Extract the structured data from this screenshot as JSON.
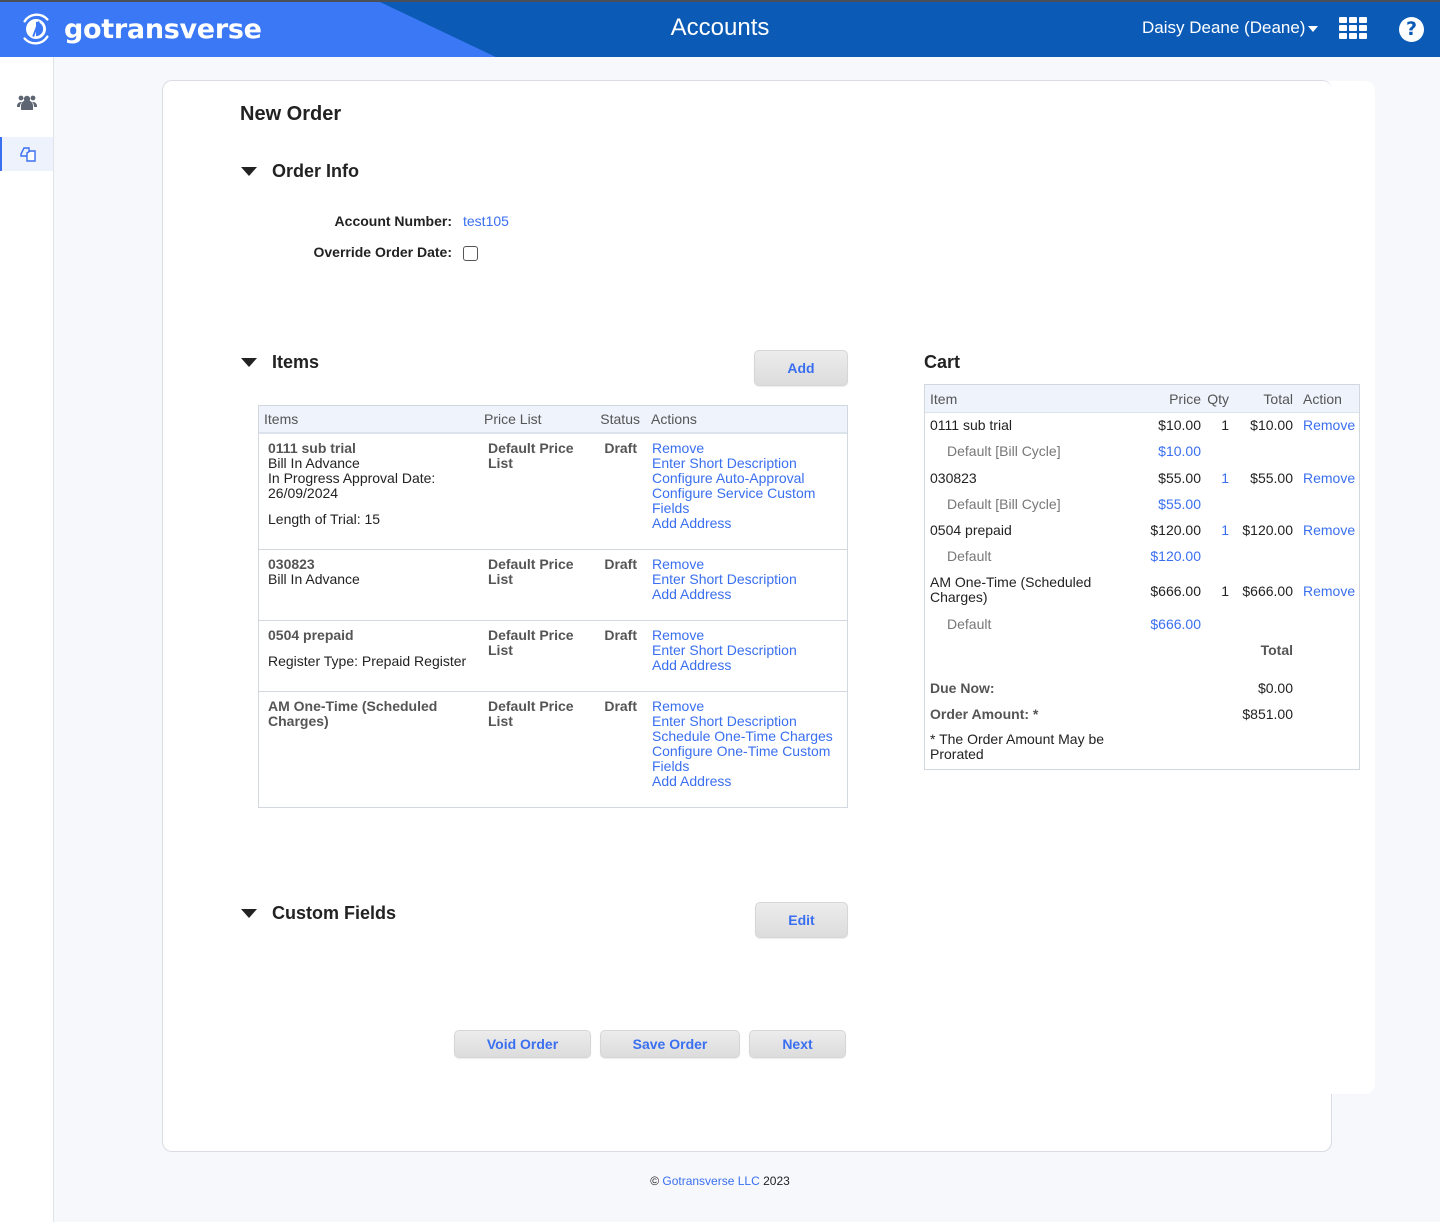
{
  "header": {
    "brand": "gotransverse",
    "title": "Accounts",
    "user": "Daisy Deane (Deane)",
    "help_glyph": "?",
    "icons": [
      "logo-icon",
      "apps-grid-icon",
      "help-icon"
    ],
    "colors": {
      "bar": "#0b5bb6",
      "brand_panel": "#3b78f5",
      "link": "#3a6ff0"
    }
  },
  "sidebar": {
    "items": [
      {
        "name": "accounts",
        "icon": "users-icon",
        "active": false
      },
      {
        "name": "orders",
        "icon": "orders-icon",
        "active": true
      }
    ]
  },
  "page": {
    "title": "New Order",
    "order_info": {
      "heading": "Order Info",
      "account_number_label": "Account Number:",
      "account_number": "test105",
      "override_date_label": "Override Order Date:",
      "override_date_checked": false
    },
    "items": {
      "heading": "Items",
      "add_label": "Add",
      "columns": [
        "Items",
        "Price List",
        "Status",
        "Actions"
      ],
      "rows": [
        {
          "name": "0111 sub trial",
          "details": [
            "Bill In Advance",
            "In Progress Approval Date:",
            "26/09/2024"
          ],
          "extra": "Length of Trial: 15",
          "price_list": "Default Price List",
          "status": "Draft",
          "actions": [
            "Remove",
            "Enter Short Description",
            "Configure Auto-Approval",
            "Configure Service Custom Fields",
            "Add Address"
          ]
        },
        {
          "name": "030823",
          "details": [
            "Bill In Advance"
          ],
          "extra": "",
          "price_list": "Default Price List",
          "status": "Draft",
          "actions": [
            "Remove",
            "Enter Short Description",
            "Add Address"
          ]
        },
        {
          "name": "0504 prepaid",
          "details": [],
          "extra": "Register Type: Prepaid Register",
          "price_list": "Default Price List",
          "status": "Draft",
          "actions": [
            "Remove",
            "Enter Short Description",
            "Add Address"
          ]
        },
        {
          "name": "AM One-Time (Scheduled Charges)",
          "details": [],
          "extra": "",
          "price_list": "Default Price List",
          "status": "Draft",
          "actions": [
            "Remove",
            "Enter Short Description",
            "Schedule One-Time Charges",
            "Configure One-Time Custom Fields",
            "Add Address"
          ]
        }
      ]
    },
    "custom_fields": {
      "heading": "Custom Fields",
      "edit_label": "Edit"
    },
    "buttons": {
      "void": "Void Order",
      "save": "Save Order",
      "next": "Next"
    }
  },
  "cart": {
    "title": "Cart",
    "columns": {
      "item": "Item",
      "price": "Price",
      "qty": "Qty",
      "total": "Total",
      "action": "Action"
    },
    "rows": [
      {
        "item": "0111 sub trial",
        "price": "$10.00",
        "qty": "1",
        "qty_link": false,
        "total": "$10.00",
        "action": "Remove",
        "sub_label": "Default [Bill Cycle]",
        "sub_price": "$10.00"
      },
      {
        "item": "030823",
        "price": "$55.00",
        "qty": "1",
        "qty_link": true,
        "total": "$55.00",
        "action": "Remove",
        "sub_label": "Default [Bill Cycle]",
        "sub_price": "$55.00"
      },
      {
        "item": "0504 prepaid",
        "price": "$120.00",
        "qty": "1",
        "qty_link": true,
        "total": "$120.00",
        "action": "Remove",
        "sub_label": "Default",
        "sub_price": "$120.00"
      },
      {
        "item": "AM One-Time (Scheduled Charges)",
        "price": "$666.00",
        "qty": "1",
        "qty_link": false,
        "total": "$666.00",
        "action": "Remove",
        "sub_label": "Default",
        "sub_price": "$666.00"
      }
    ],
    "total_label": "Total",
    "due_now_label": "Due Now:",
    "due_now": "$0.00",
    "order_amount_label": "Order Amount: *",
    "order_amount": "$851.00",
    "note": "* The Order Amount May be Prorated"
  },
  "footer": {
    "copy": "©",
    "company": "Gotransverse LLC",
    "year": "2023"
  }
}
